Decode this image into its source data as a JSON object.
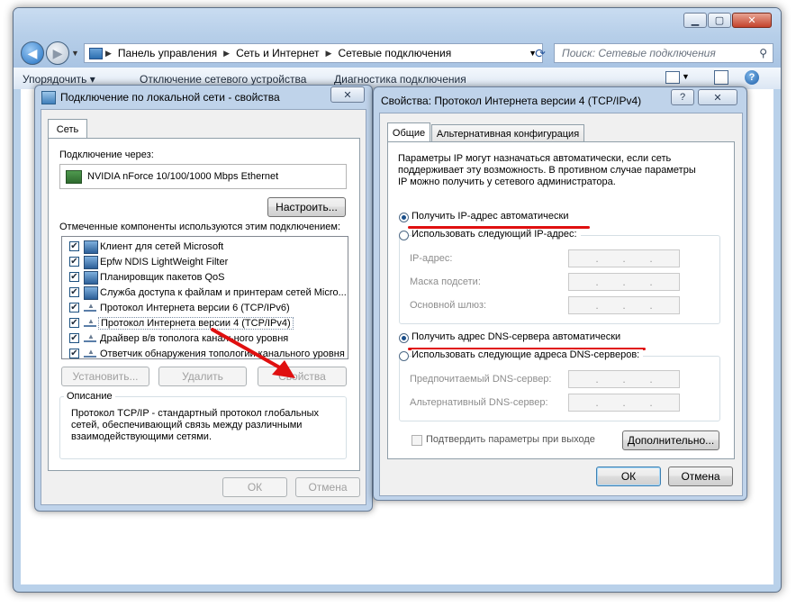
{
  "explorer": {
    "breadcrumb": [
      "Панель управления",
      "Сеть и Интернет",
      "Сетевые подключения"
    ],
    "search_placeholder": "Поиск: Сетевые подключения",
    "toolbar": [
      "Упорядочить ▾",
      "Отключение сетевого устройства",
      "Диагностика подключения"
    ]
  },
  "lan_dialog": {
    "title": "Подключение по локальной сети - свойства",
    "tab": "Сеть",
    "connect_using_label": "Подключение через:",
    "adapter": "NVIDIA nForce 10/100/1000 Mbps Ethernet",
    "configure_button": "Настроить...",
    "components_label": "Отмеченные компоненты используются этим подключением:",
    "components": [
      {
        "label": "Клиент для сетей Microsoft",
        "checked": true,
        "icon": "network-client-icon"
      },
      {
        "label": "Epfw NDIS LightWeight Filter",
        "checked": true,
        "icon": "filter-driver-icon"
      },
      {
        "label": "Планировщик пакетов QoS",
        "checked": true,
        "icon": "qos-scheduler-icon"
      },
      {
        "label": "Служба доступа к файлам и принтерам сетей Micro...",
        "checked": true,
        "icon": "file-printer-sharing-icon"
      },
      {
        "label": "Протокол Интернета версии 6 (TCP/IPv6)",
        "checked": true,
        "icon": "protocol-icon"
      },
      {
        "label": "Протокол Интернета версии 4 (TCP/IPv4)",
        "checked": true,
        "icon": "protocol-icon",
        "selected": true
      },
      {
        "label": "Драйвер в/в тополога канального уровня",
        "checked": true,
        "icon": "protocol-icon"
      },
      {
        "label": "Ответчик обнаружения топологии канального уровня",
        "checked": true,
        "icon": "protocol-icon"
      }
    ],
    "install_button": "Установить...",
    "remove_button": "Удалить",
    "properties_button": "Свойства",
    "description_title": "Описание",
    "description_text": "Протокол TCP/IP - стандартный протокол глобальных сетей, обеспечивающий связь между различными взаимодействующими сетями.",
    "ok_button": "ОК",
    "cancel_button": "Отмена"
  },
  "ipv4_dialog": {
    "title": "Свойства: Протокол Интернета версии 4 (TCP/IPv4)",
    "help_button": "?",
    "tabs": [
      "Общие",
      "Альтернативная конфигурация"
    ],
    "info_text": "Параметры IP могут назначаться автоматически, если сеть поддерживает эту возможность. В противном случае параметры IP можно получить у сетевого администратора.",
    "ip_auto_label": "Получить IP-адрес автоматически",
    "ip_manual_label": "Использовать следующий IP-адрес:",
    "ip_auto_selected": true,
    "ip_address_label": "IP-адрес:",
    "subnet_mask_label": "Маска подсети:",
    "gateway_label": "Основной шлюз:",
    "dns_auto_label": "Получить адрес DNS-сервера автоматически",
    "dns_manual_label": "Использовать следующие адреса DNS-серверов:",
    "dns_auto_selected": true,
    "preferred_dns_label": "Предпочитаемый DNS-сервер:",
    "alternate_dns_label": "Альтернативный DNS-сервер:",
    "validate_on_exit_label": "Подтвердить параметры при выходе",
    "validate_on_exit_checked": false,
    "advanced_button": "Дополнительно...",
    "ok_button": "ОК",
    "cancel_button": "Отмена"
  },
  "colors": {
    "annotation_red": "#e01010",
    "window_frame": "#bfd3ea"
  }
}
